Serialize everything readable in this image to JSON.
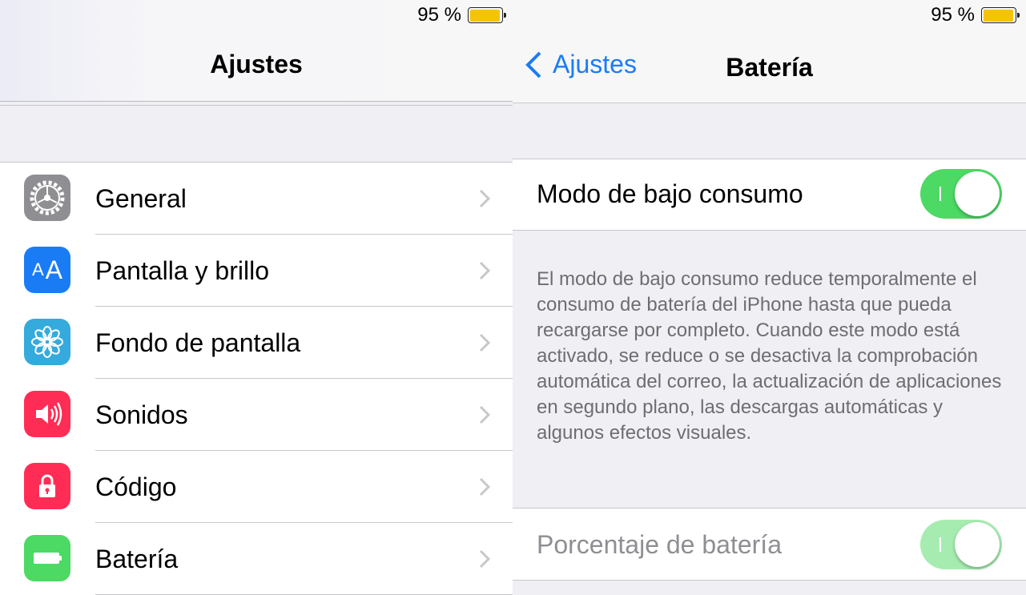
{
  "left": {
    "status": {
      "battery_text": "95 %",
      "battery_level": 0.95
    },
    "title": "Ajustes",
    "items": [
      {
        "label": "General",
        "icon": "gear-icon",
        "color": "#8e8e93"
      },
      {
        "label": "Pantalla y brillo",
        "icon": "text-size-icon",
        "color": "#1a7cf5"
      },
      {
        "label": "Fondo de pantalla",
        "icon": "flower-icon",
        "color": "#35aadc"
      },
      {
        "label": "Sonidos",
        "icon": "speaker-icon",
        "color": "#ff2d55"
      },
      {
        "label": "Código",
        "icon": "lock-icon",
        "color": "#ff2d55"
      },
      {
        "label": "Batería",
        "icon": "battery-icon",
        "color": "#4cd964"
      }
    ],
    "icon_text_size": "AA"
  },
  "right": {
    "status": {
      "battery_text": "95 %",
      "battery_level": 0.95
    },
    "back_label": "Ajustes",
    "title": "Batería",
    "low_power": {
      "label": "Modo de bajo consumo",
      "on": true
    },
    "description": "El modo de bajo consumo reduce temporalmente el consumo de batería del iPhone hasta que pueda recargarse por completo. Cuando este modo está activado, se reduce o se desactiva la comprobación automática del correo, la actualización de aplicaciones en segundo plano, las descargas automáticas y algunos efectos visuales.",
    "percentage": {
      "label": "Porcentaje de batería",
      "on": true,
      "disabled": true
    }
  },
  "colors": {
    "accent": "#1a7cf5",
    "toggle_on": "#4cd964",
    "battery_fill": "#f5c400"
  }
}
